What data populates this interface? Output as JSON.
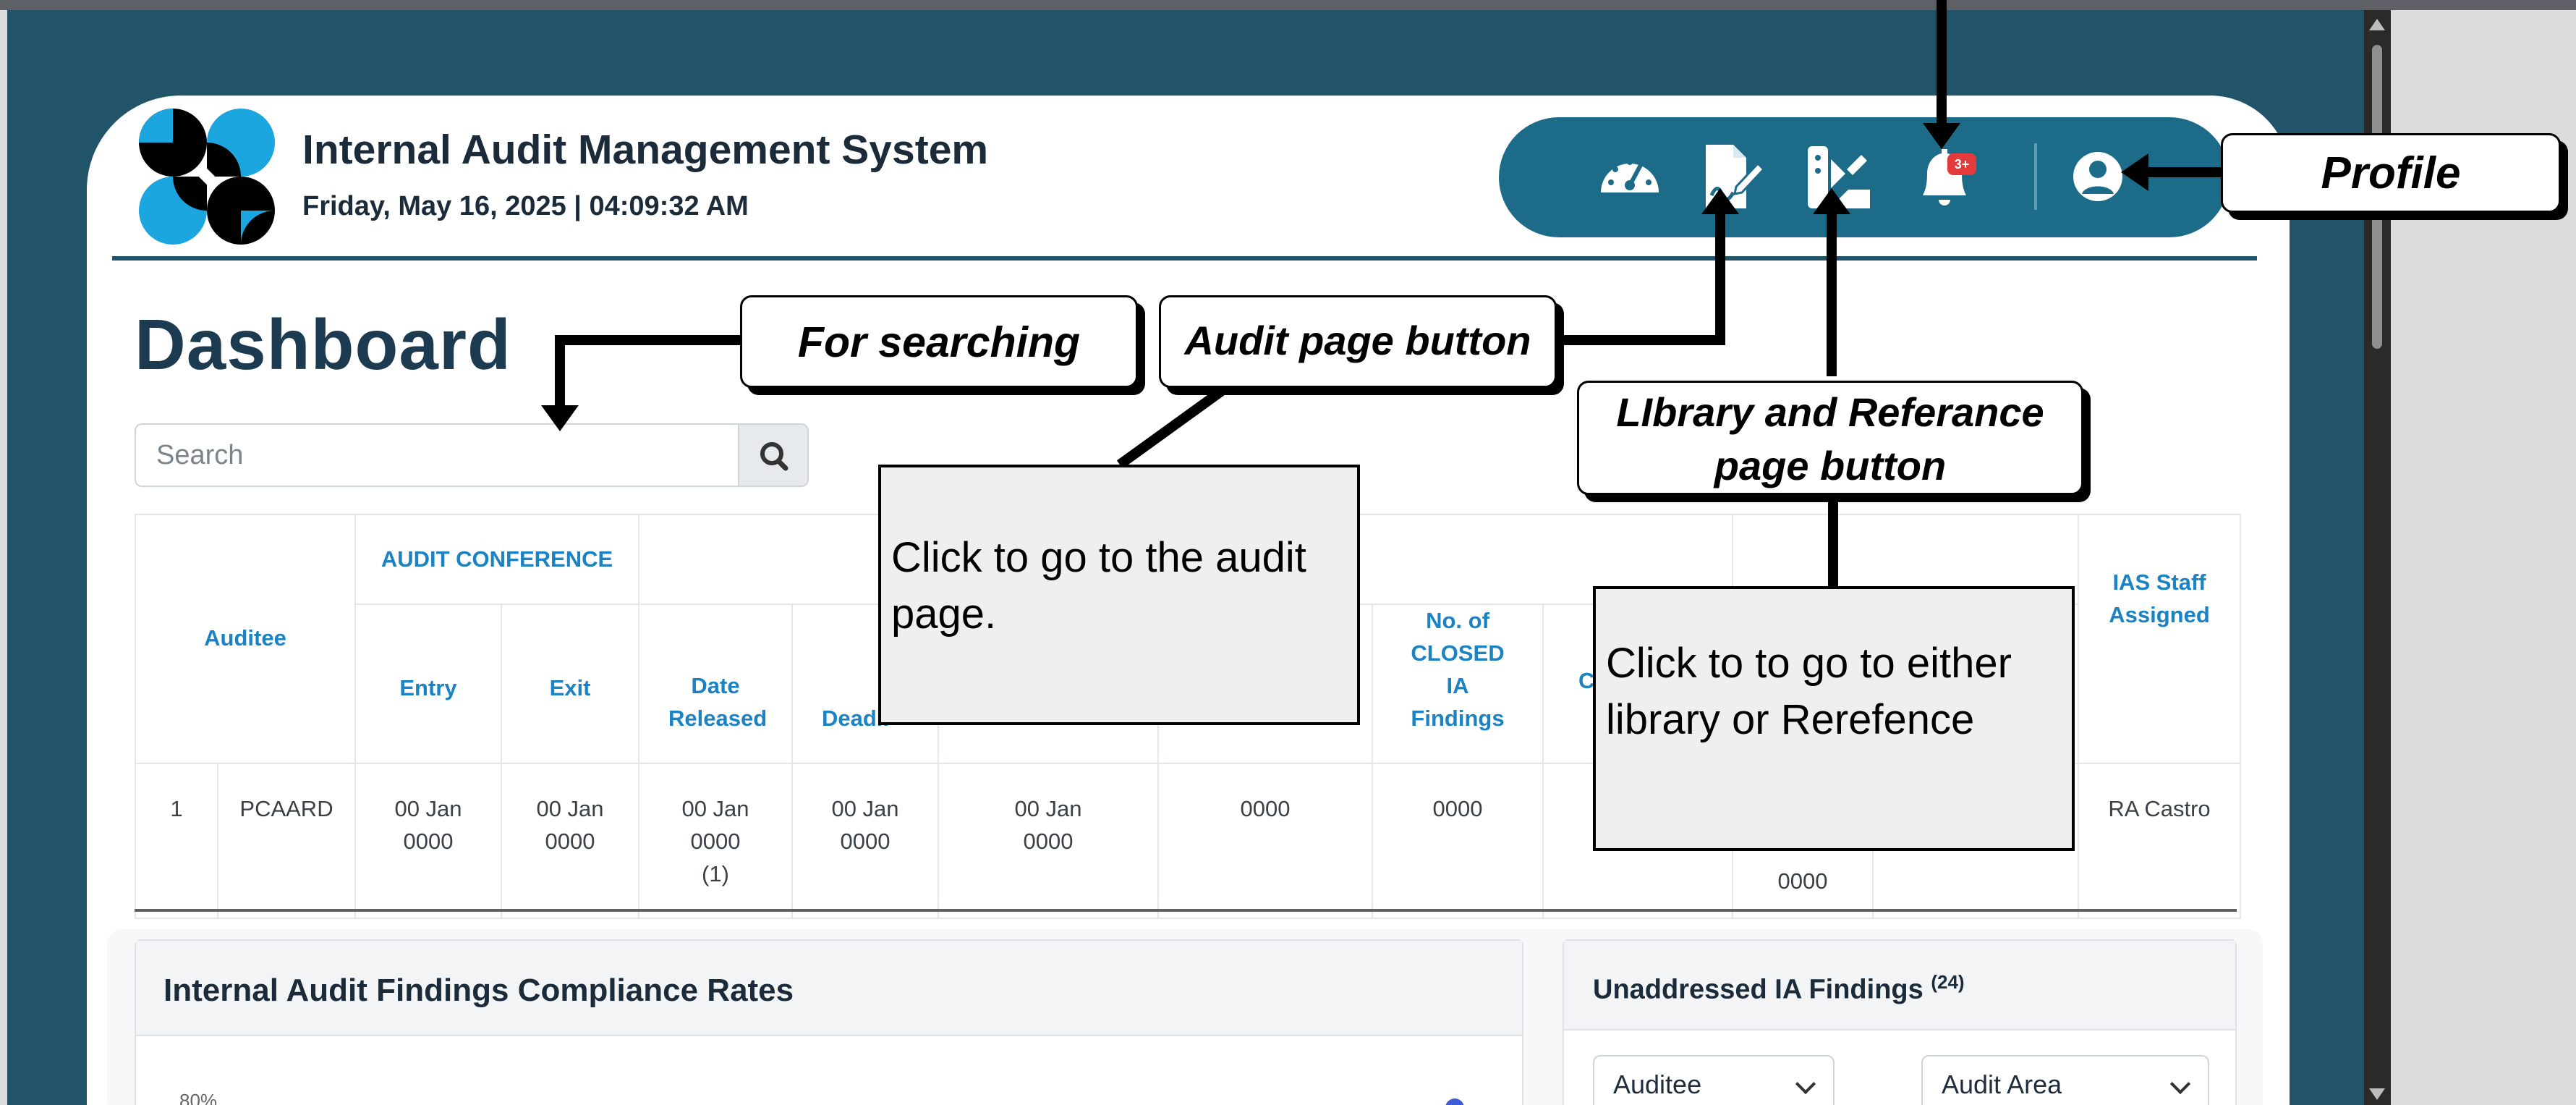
{
  "app": {
    "title": "Internal Audit Management System",
    "datetime": "Friday, May 16, 2025 | 04:09:32 AM",
    "colors": {
      "frame": "#215468",
      "nav_pill": "#1b6b89",
      "header_text": "#1b82c4",
      "badge": "#e33b3b"
    }
  },
  "nav": {
    "icons": [
      "dashboard-icon",
      "audit-signature-icon",
      "library-reference-icon",
      "bell-icon",
      "user-circle-icon"
    ],
    "notification_badge": "3+"
  },
  "page": {
    "title": "Dashboard"
  },
  "search": {
    "placeholder": "Search",
    "icon": "search-icon"
  },
  "table": {
    "headers": {
      "auditee": "Auditee",
      "audit_conference": "AUDIT CONFERENCE",
      "entry": "Entry",
      "exit": "Exit",
      "date_released": "Date Released",
      "deadline": "Deadli",
      "no_closed": "No. of CLOSED IA Findings",
      "col_c": "C",
      "ias_staff": "IAS Staff Assigned"
    },
    "row": {
      "num": "1",
      "auditee": "PCAARD",
      "entry": "00 Jan 0000",
      "exit": "00 Jan 0000",
      "date_released": "00 Jan 0000 (1)",
      "deadline": "00 Jan 0000",
      "col6": "00 Jan 0000",
      "col7": "0000",
      "no_closed": "0000",
      "col10": "0000",
      "ias_staff": "RA Castro"
    }
  },
  "panels": {
    "compliance": {
      "title": "Internal Audit Findings Compliance Rates",
      "tick_top": "80%"
    },
    "unaddressed": {
      "title": "Unaddressed IA Findings",
      "count": "(24)",
      "filter_auditee": "Auditee",
      "filter_area": "Audit Area"
    }
  },
  "annotations": {
    "searching": "For searching",
    "audit_page": "Audit page button",
    "library_ref": "LIbrary and Referance page button",
    "library_ref_line1": "LIbrary and Referance",
    "library_ref_line2": "page button",
    "profile": "Profile",
    "audit_note": "Click to go to the audit page.",
    "library_note": "Click to to go to either library or Rerefence"
  }
}
